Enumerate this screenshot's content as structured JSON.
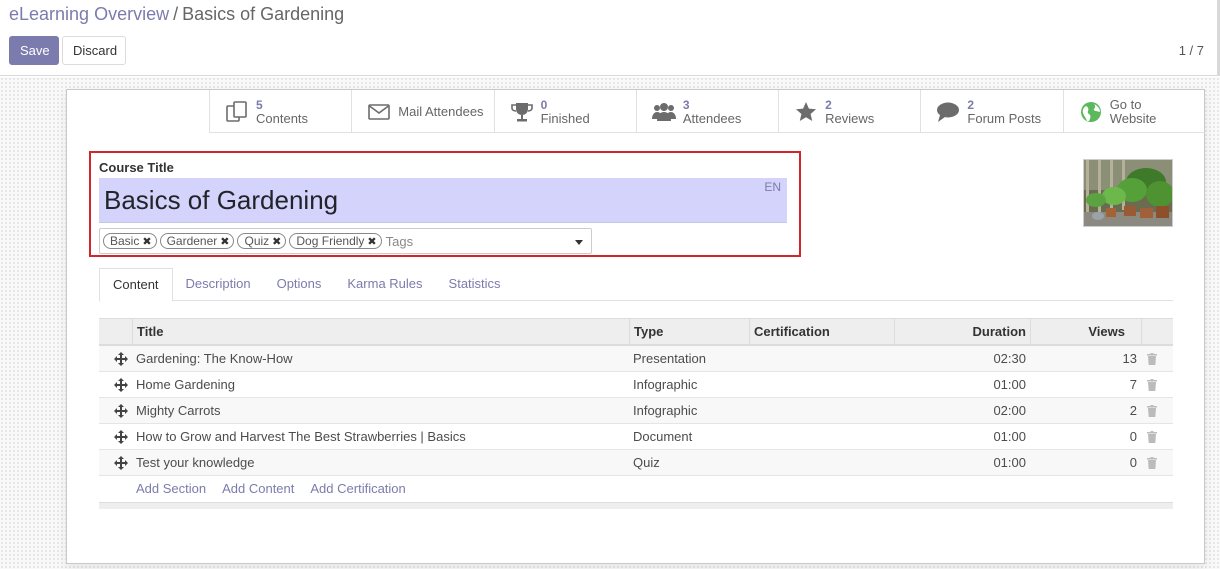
{
  "breadcrumb": {
    "parent": "eLearning Overview",
    "separator": "/",
    "current": "Basics of Gardening"
  },
  "toolbar": {
    "save_label": "Save",
    "discard_label": "Discard"
  },
  "pager": {
    "value": "1 / 7"
  },
  "stat_buttons": [
    {
      "number": "5",
      "label": "Contents",
      "icon": "files-icon"
    },
    {
      "label": "Mail Attendees",
      "icon": "envelope-icon"
    },
    {
      "number": "0",
      "label": "Finished",
      "icon": "trophy-icon"
    },
    {
      "number": "3",
      "label": "Attendees",
      "icon": "users-icon"
    },
    {
      "number": "2",
      "label": "Reviews",
      "icon": "star-icon"
    },
    {
      "number": "2",
      "label": "Forum Posts",
      "icon": "comment-icon"
    },
    {
      "line1": "Go to",
      "line2": "Website",
      "icon": "globe-icon"
    }
  ],
  "course": {
    "title_label": "Course Title",
    "title": "Basics of Gardening",
    "lang": "EN",
    "tags": [
      "Basic",
      "Gardener",
      "Quiz",
      "Dog Friendly"
    ],
    "tags_placeholder": "Tags"
  },
  "tabs": [
    "Content",
    "Description",
    "Options",
    "Karma Rules",
    "Statistics"
  ],
  "table": {
    "headers": [
      "Title",
      "Type",
      "Certification",
      "Duration",
      "Views"
    ],
    "rows": [
      {
        "title": "Gardening: The Know-How",
        "type": "Presentation",
        "certification": "",
        "duration": "02:30",
        "views": "13"
      },
      {
        "title": "Home Gardening",
        "type": "Infographic",
        "certification": "",
        "duration": "01:00",
        "views": "7"
      },
      {
        "title": "Mighty Carrots",
        "type": "Infographic",
        "certification": "",
        "duration": "02:00",
        "views": "2"
      },
      {
        "title": "How to Grow and Harvest The Best Strawberries | Basics",
        "type": "Document",
        "certification": "",
        "duration": "01:00",
        "views": "0"
      },
      {
        "title": "Test your knowledge",
        "type": "Quiz",
        "certification": "",
        "duration": "01:00",
        "views": "0"
      }
    ],
    "add_links": [
      "Add Section",
      "Add Content",
      "Add Certification"
    ]
  },
  "colors": {
    "brand": "#7c7bad",
    "title_bg": "#d3d3fb",
    "highlight_border": "#d3252a"
  }
}
